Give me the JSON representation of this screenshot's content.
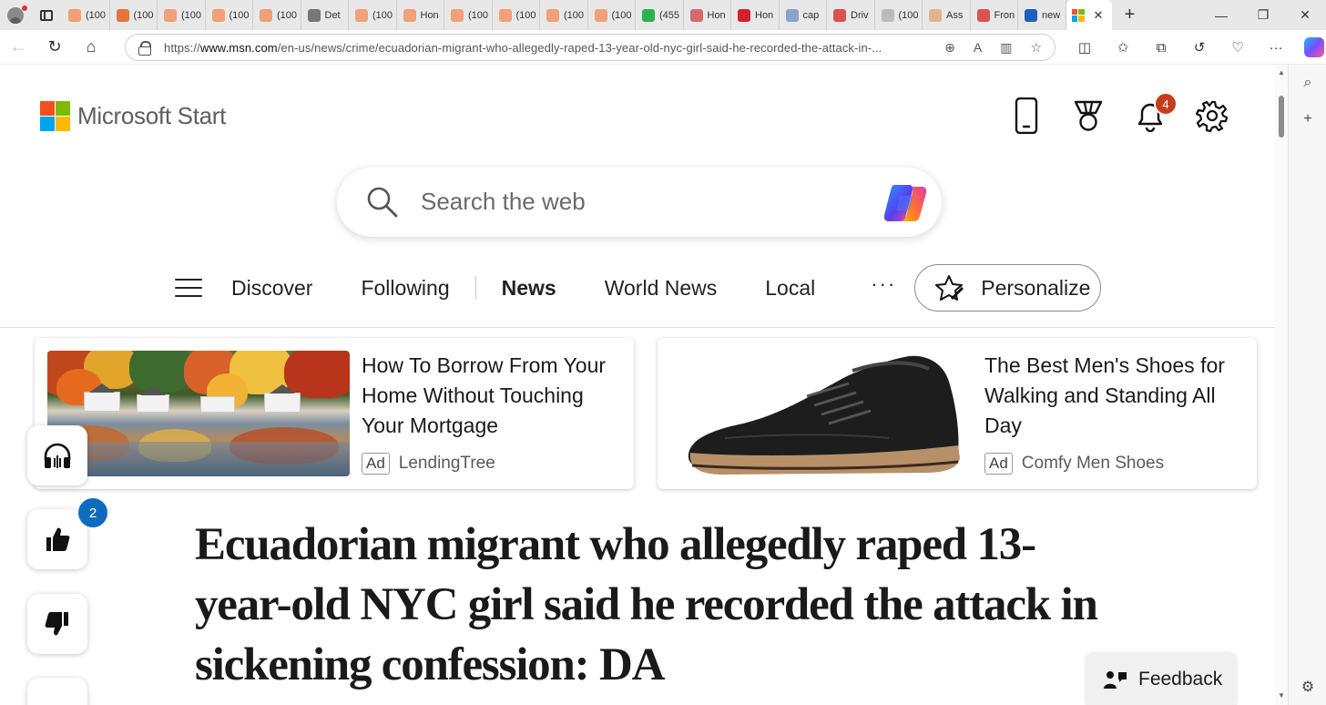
{
  "browser": {
    "tabs": [
      {
        "label": "(100",
        "color": "#f0a07a"
      },
      {
        "label": "(100",
        "color": "#e8743c"
      },
      {
        "label": "(100",
        "color": "#f0a07a"
      },
      {
        "label": "(100",
        "color": "#f0a07a"
      },
      {
        "label": "(100",
        "color": "#f0a07a"
      },
      {
        "label": "Det",
        "color": "#777777"
      },
      {
        "label": "(100",
        "color": "#f0a07a"
      },
      {
        "label": "Hon",
        "color": "#f0a07a"
      },
      {
        "label": "(100",
        "color": "#f0a07a"
      },
      {
        "label": "(100",
        "color": "#f0a07a"
      },
      {
        "label": "(100",
        "color": "#f0a07a"
      },
      {
        "label": "(100",
        "color": "#f0a07a"
      },
      {
        "label": "(455",
        "color": "#2bb24c"
      },
      {
        "label": "Hon",
        "color": "#d46a6a"
      },
      {
        "label": "Hon",
        "color": "#d4202a"
      },
      {
        "label": "cap",
        "color": "#8aa3c9"
      },
      {
        "label": "Driv",
        "color": "#d9534f"
      },
      {
        "label": "(100",
        "color": "#bbbbbb"
      },
      {
        "label": "Ass",
        "color": "#e0b58a"
      },
      {
        "label": "Fron",
        "color": "#d9534f"
      },
      {
        "label": "new",
        "color": "#1f5fbf"
      }
    ],
    "url_prefix": "https://",
    "url_host": "www.msn.com",
    "url_path": "/en-us/news/crime/ecuadorian-migrant-who-allegedly-raped-13-year-old-nyc-girl-said-he-recorded-the-attack-in-..."
  },
  "header": {
    "brand": "Microsoft Start",
    "notification_count": "4"
  },
  "search": {
    "placeholder": "Search the web"
  },
  "nav": {
    "items": [
      "Discover",
      "Following",
      "News",
      "World News",
      "Local"
    ],
    "more": "···",
    "personalize": "Personalize"
  },
  "ads": [
    {
      "title": "How To Borrow From Your Home Without Touching Your Mortgage",
      "tag": "Ad",
      "source": "LendingTree"
    },
    {
      "title": "The Best Men's Shoes for Walking and Standing All Day",
      "tag": "Ad",
      "source": "Comfy Men Shoes"
    }
  ],
  "reactions": {
    "like_count": "2"
  },
  "article": {
    "headline": "Ecuadorian migrant who allegedly raped 13-year-old NYC girl said he recorded the attack in sickening confession: DA"
  },
  "feedback": {
    "label": "Feedback"
  },
  "colors": {
    "ms_red": "#f25022",
    "ms_green": "#7fba00",
    "ms_blue": "#00a4ef",
    "ms_yellow": "#ffb900",
    "notification_badge": "#c43e1c",
    "count_badge": "#0f6cbd"
  }
}
